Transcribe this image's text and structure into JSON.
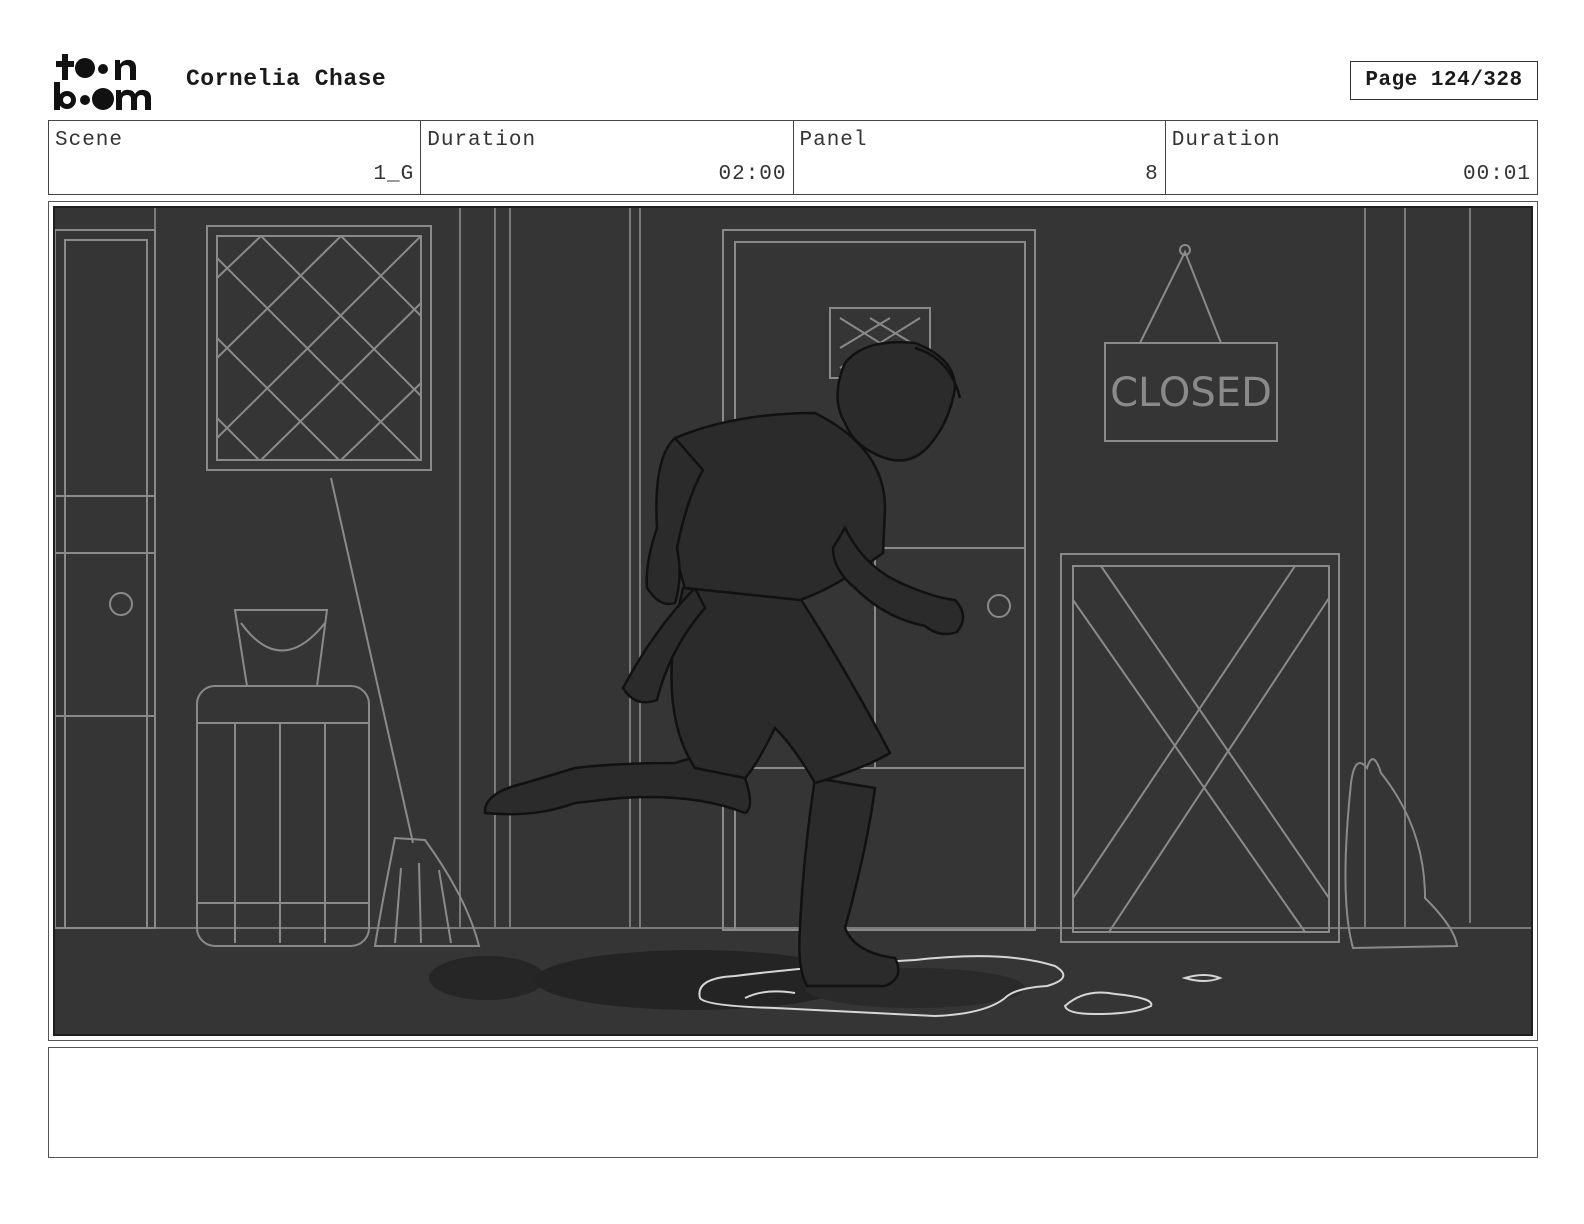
{
  "header": {
    "logo_alt": "toon boom",
    "project_title": "Cornelia Chase",
    "page_label": "Page 124/328"
  },
  "info": {
    "scene_label": "Scene",
    "scene_value": "1_G",
    "scene_duration_label": "Duration",
    "scene_duration_value": "02:00",
    "panel_label": "Panel",
    "panel_value": "8",
    "panel_duration_label": "Duration",
    "panel_duration_value": "00:01"
  },
  "panel": {
    "sign_text": "CLOSED",
    "background_color": "#353535",
    "line_color": "#8a8a8a"
  },
  "caption": {
    "text": ""
  }
}
